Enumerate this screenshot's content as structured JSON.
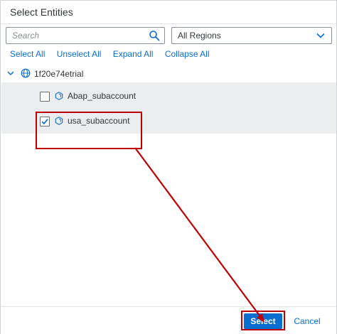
{
  "dialog": {
    "title": "Select Entities"
  },
  "search": {
    "placeholder": "Search",
    "value": ""
  },
  "region_filter": {
    "selected": "All Regions"
  },
  "actions": {
    "select_all": "Select All",
    "unselect_all": "Unselect All",
    "expand_all": "Expand All",
    "collapse_all": "Collapse All"
  },
  "tree": {
    "root": {
      "label": "1f20e74etrial",
      "expanded": true
    },
    "items": [
      {
        "label": "Abap_subaccount",
        "checked": false
      },
      {
        "label": "usa_subaccount",
        "checked": true
      }
    ]
  },
  "footer": {
    "select_label": "Select",
    "cancel_label": "Cancel"
  },
  "colors": {
    "accent": "#0a6ed1",
    "annotation": "#c00000",
    "row_bg": "#ecedee"
  }
}
